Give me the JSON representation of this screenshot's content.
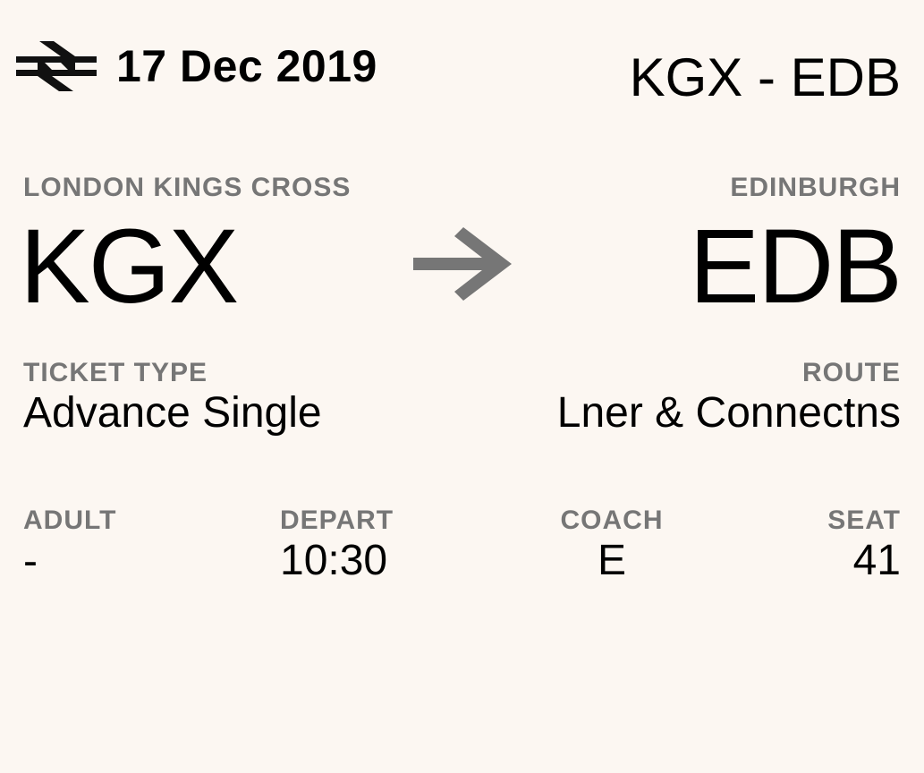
{
  "header": {
    "logo_icon": "british-rail-double-arrow-icon",
    "date": "17 Dec 2019",
    "route_short": "KGX - EDB"
  },
  "origin": {
    "name": "LONDON KINGS CROSS",
    "code": "KGX"
  },
  "destination": {
    "name": "EDINBURGH",
    "code": "EDB"
  },
  "direction_icon": "right-arrow-icon",
  "ticket_type": {
    "label": "TICKET TYPE",
    "value": "Advance Single"
  },
  "route": {
    "label": "ROUTE",
    "value": "Lner & Connectns"
  },
  "details": {
    "adult": {
      "label": "ADULT",
      "value": "-"
    },
    "depart": {
      "label": "DEPART",
      "value": "10:30"
    },
    "coach": {
      "label": "COACH",
      "value": "E"
    },
    "seat": {
      "label": "SEAT",
      "value": "41"
    }
  },
  "colors": {
    "background": "#fcf7f2",
    "label": "#767676",
    "text": "#000000",
    "arrow": "#767676"
  }
}
